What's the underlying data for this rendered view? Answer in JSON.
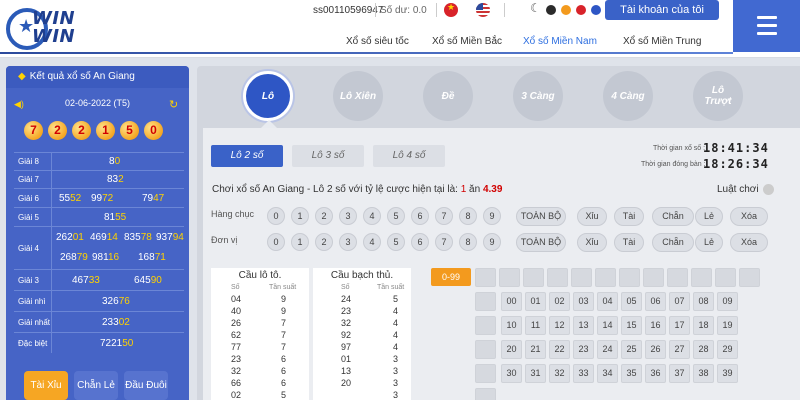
{
  "header": {
    "logo_line1": "WIN",
    "logo_line2": "WIN",
    "account_id": "ss00110596947",
    "balance": "Số dư: 0.0",
    "account_button": "Tài khoản của tôi",
    "theme_colors": [
      "#2b2b2b",
      "#f39a1e",
      "#d8232a",
      "#2e56c5"
    ],
    "nav": [
      "Xổ số siêu tốc",
      "Xổ số Miền Bắc",
      "Xổ số Miền Nam",
      "Xổ số Miền Trung"
    ],
    "nav_active": "Xổ số Miền Nam"
  },
  "sidebar": {
    "title": "Kết quả xổ số An Giang",
    "date": "02-06-2022 (T5)",
    "balls": [
      "7",
      "2",
      "2",
      "1",
      "5",
      "0"
    ],
    "prizes": [
      {
        "label": "Giải 8",
        "values": [
          "80"
        ]
      },
      {
        "label": "Giải 7",
        "values": [
          "832"
        ]
      },
      {
        "label": "Giải 6",
        "values": [
          "5552",
          "9972",
          "7947"
        ]
      },
      {
        "label": "Giải 5",
        "values": [
          "8155"
        ]
      },
      {
        "label": "Giải 4",
        "values": [
          "26201",
          "46914",
          "83578",
          "93794",
          "26879",
          "98116",
          "16871"
        ]
      },
      {
        "label": "Giải 3",
        "values": [
          "46733",
          "64590"
        ]
      },
      {
        "label": "Giải nhì",
        "values": [
          "32676"
        ]
      },
      {
        "label": "Giải nhất",
        "values": [
          "23302"
        ]
      },
      {
        "label": "Đặc biệt",
        "values": [
          "722150"
        ]
      }
    ],
    "buttons": [
      "Tài Xỉu",
      "Chẵn Lẻ",
      "Đầu Đuôi"
    ]
  },
  "categories": [
    "Lô",
    "Lô Xiên",
    "Đề",
    "3 Càng",
    "4 Càng",
    "Lô Trượt"
  ],
  "sub_tabs": [
    "Lô 2 số",
    "Lô 3 số",
    "Lô 4 số"
  ],
  "timer": {
    "lottery_label": "Thời gian xổ số :",
    "lottery_time": "18:41:34",
    "close_label": "Thời gian đóng bàn :",
    "close_time": "18:26:34"
  },
  "play": {
    "prefix": "Chơi xổ số ",
    "game": "An Giang - Lô 2 số",
    "middle": " với tỷ lệ cược hiện tại là: ",
    "one": "1",
    "an": " ăn ",
    "rate": "4.39",
    "rules": "Luật chơi"
  },
  "rows": [
    {
      "label": "Hàng chục"
    },
    {
      "label": "Đơn vị"
    }
  ],
  "digits": [
    "0",
    "1",
    "2",
    "3",
    "4",
    "5",
    "6",
    "7",
    "8",
    "9"
  ],
  "quick_buttons": [
    "TOÀN BỘ",
    "Xỉu",
    "Tài",
    "Chẵn",
    "Lẻ",
    "Xóa"
  ],
  "stats": {
    "lo_title": "Cầu lô tô.",
    "bach_title": "Cầu bạch thủ.",
    "col_so": "Số",
    "col_freq": "Tần suất",
    "lo": [
      [
        "04",
        "9"
      ],
      [
        "40",
        "9"
      ],
      [
        "26",
        "7"
      ],
      [
        "62",
        "7"
      ],
      [
        "77",
        "7"
      ],
      [
        "23",
        "6"
      ],
      [
        "32",
        "6"
      ],
      [
        "66",
        "6"
      ],
      [
        "02",
        "5"
      ]
    ],
    "bach": [
      [
        "24",
        "5"
      ],
      [
        "23",
        "4"
      ],
      [
        "32",
        "4"
      ],
      [
        "92",
        "4"
      ],
      [
        "97",
        "4"
      ],
      [
        "01",
        "3"
      ],
      [
        "13",
        "3"
      ],
      [
        "20",
        "3"
      ],
      [
        "",
        "3"
      ]
    ]
  },
  "range_button": "0-99",
  "numbers_row1": [
    "00",
    "01",
    "02",
    "03",
    "04",
    "05",
    "06",
    "07",
    "08",
    "09"
  ],
  "numbers_row2": [
    "10",
    "11",
    "12",
    "13",
    "14",
    "15",
    "16",
    "17",
    "18",
    "19"
  ],
  "numbers_row3": [
    "20",
    "21",
    "22",
    "23",
    "24",
    "25",
    "26",
    "27",
    "28",
    "29"
  ],
  "numbers_row4": [
    "30",
    "31",
    "32",
    "33",
    "34",
    "35",
    "36",
    "37",
    "38",
    "39"
  ]
}
